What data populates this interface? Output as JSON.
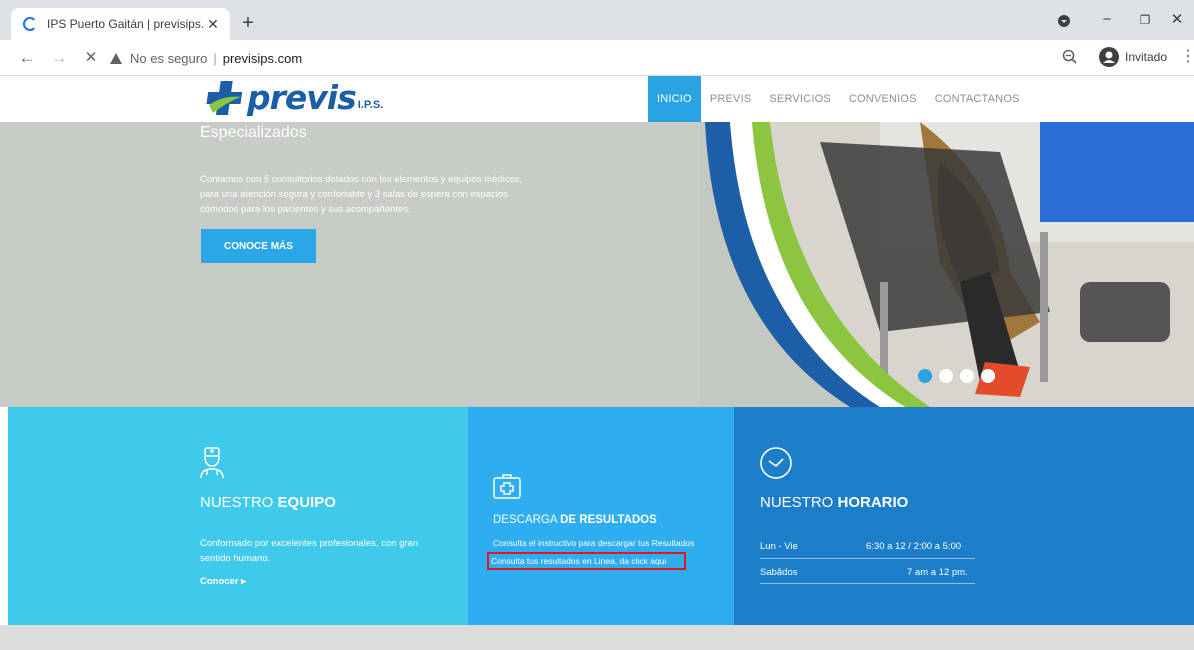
{
  "browser": {
    "tab_title": "IPS Puerto Gaitán | previsips.com",
    "tab_close": "✕",
    "new_tab": "+",
    "security_text": "No es seguro",
    "separator": "|",
    "url": "previsips.com",
    "profile_label": "Invitado",
    "window_controls": {
      "minimize": "−",
      "maximize": "❐",
      "close": "✕"
    },
    "nav": {
      "back": "←",
      "forward": "→",
      "stop": "✕"
    },
    "menu_glyph": "⋮"
  },
  "site": {
    "logo_text": "previs",
    "logo_suffix": "I.P.S.",
    "brand_color": "#1a5fa6",
    "accent_color": "#2aa3e3",
    "menu": [
      {
        "label": "INICIO",
        "active": true
      },
      {
        "label": "PREVIS",
        "active": false
      },
      {
        "label": "SERVICIOS",
        "active": false
      },
      {
        "label": "CONVENIOS",
        "active": false
      },
      {
        "label": "CONTACTANOS",
        "active": false
      }
    ]
  },
  "hero": {
    "heading": "Especializados",
    "body": "Contamos con 5 consultorios dotados con los elementos y equipos médicos, para una atención segura y confortable y 3 salas de espera con espacios cómodos para los pacientes y sus acompañantes.",
    "cta_label": "CONOCE MÁS",
    "slide_count": 4,
    "active_slide": 1
  },
  "blocks": {
    "equipo": {
      "icon": "doctor-icon",
      "title_light": "NUESTRO ",
      "title_bold": "EQUIPO",
      "text": "Conformado por excelentes profesionales, con gran sentido humano.",
      "link_label": "Conocer ▸"
    },
    "resultados": {
      "icon": "medical-kit-icon",
      "title_light": "DESCARGA ",
      "title_bold": "DE RESULTADOS",
      "text": "Consulta el instructivo para descargar tus Resultados",
      "link_label": "Consulta tus resultados en Linea, da click aqui"
    },
    "horario": {
      "icon": "clock-icon",
      "title_light": "NUESTRO ",
      "title_bold": "HORARIO",
      "rows": [
        {
          "day": "Lun - Vie",
          "hours": "6:30 a 12 / 2:00 a 5:00"
        },
        {
          "day": "Sabãdos",
          "hours": "7 am a 12 pm."
        }
      ]
    }
  }
}
